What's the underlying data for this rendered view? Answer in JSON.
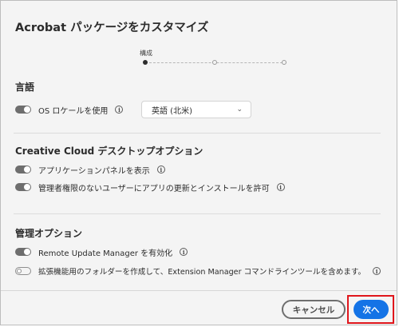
{
  "dialog": {
    "title": "Acrobat パッケージをカスタマイズ"
  },
  "stepper": {
    "current_label": "構成",
    "steps": [
      {
        "state": "active"
      },
      {
        "state": "inactive"
      },
      {
        "state": "inactive"
      }
    ]
  },
  "language": {
    "title": "言語",
    "os_locale": {
      "label": "OS ロケールを使用",
      "enabled": true
    },
    "select_value": "英語 (北米)"
  },
  "desktop": {
    "title": "Creative Cloud デスクトップオプション",
    "items": [
      {
        "label": "アプリケーションパネルを表示",
        "enabled": true
      },
      {
        "label": "管理者権限のないユーザーにアプリの更新とインストールを許可",
        "enabled": true
      }
    ]
  },
  "admin": {
    "title": "管理オプション",
    "items": [
      {
        "label": "Remote Update Manager を有効化",
        "enabled": true
      },
      {
        "label": "拡張機能用のフォルダーを作成して、Extension Manager コマンドラインツールを含めます。",
        "enabled": false
      }
    ]
  },
  "footer": {
    "cancel_label": "キャンセル",
    "next_label": "次へ"
  },
  "icons": {
    "info_glyph": "i",
    "chevron_glyph": "⌄"
  },
  "colors": {
    "primary": "#1473e6",
    "highlight": "#e0161c",
    "background": "#f4f4f4"
  }
}
